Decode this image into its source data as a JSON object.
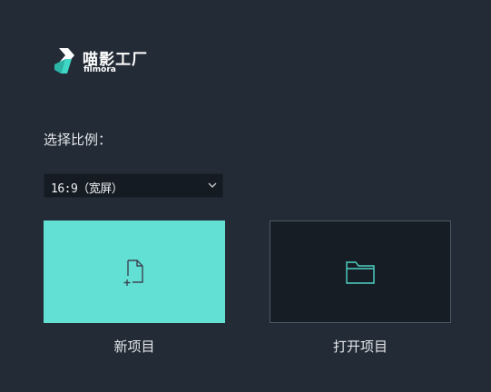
{
  "brand": {
    "name_cn": "喵影工厂",
    "name_en": "filmora",
    "accent_color": "#62e0d4"
  },
  "ratio": {
    "label": "选择比例：",
    "selected": "16:9（宽屏）"
  },
  "actions": {
    "new_project": {
      "label": "新项目",
      "icon": "new-file-icon"
    },
    "open_project": {
      "label": "打开项目",
      "icon": "folder-icon"
    }
  }
}
